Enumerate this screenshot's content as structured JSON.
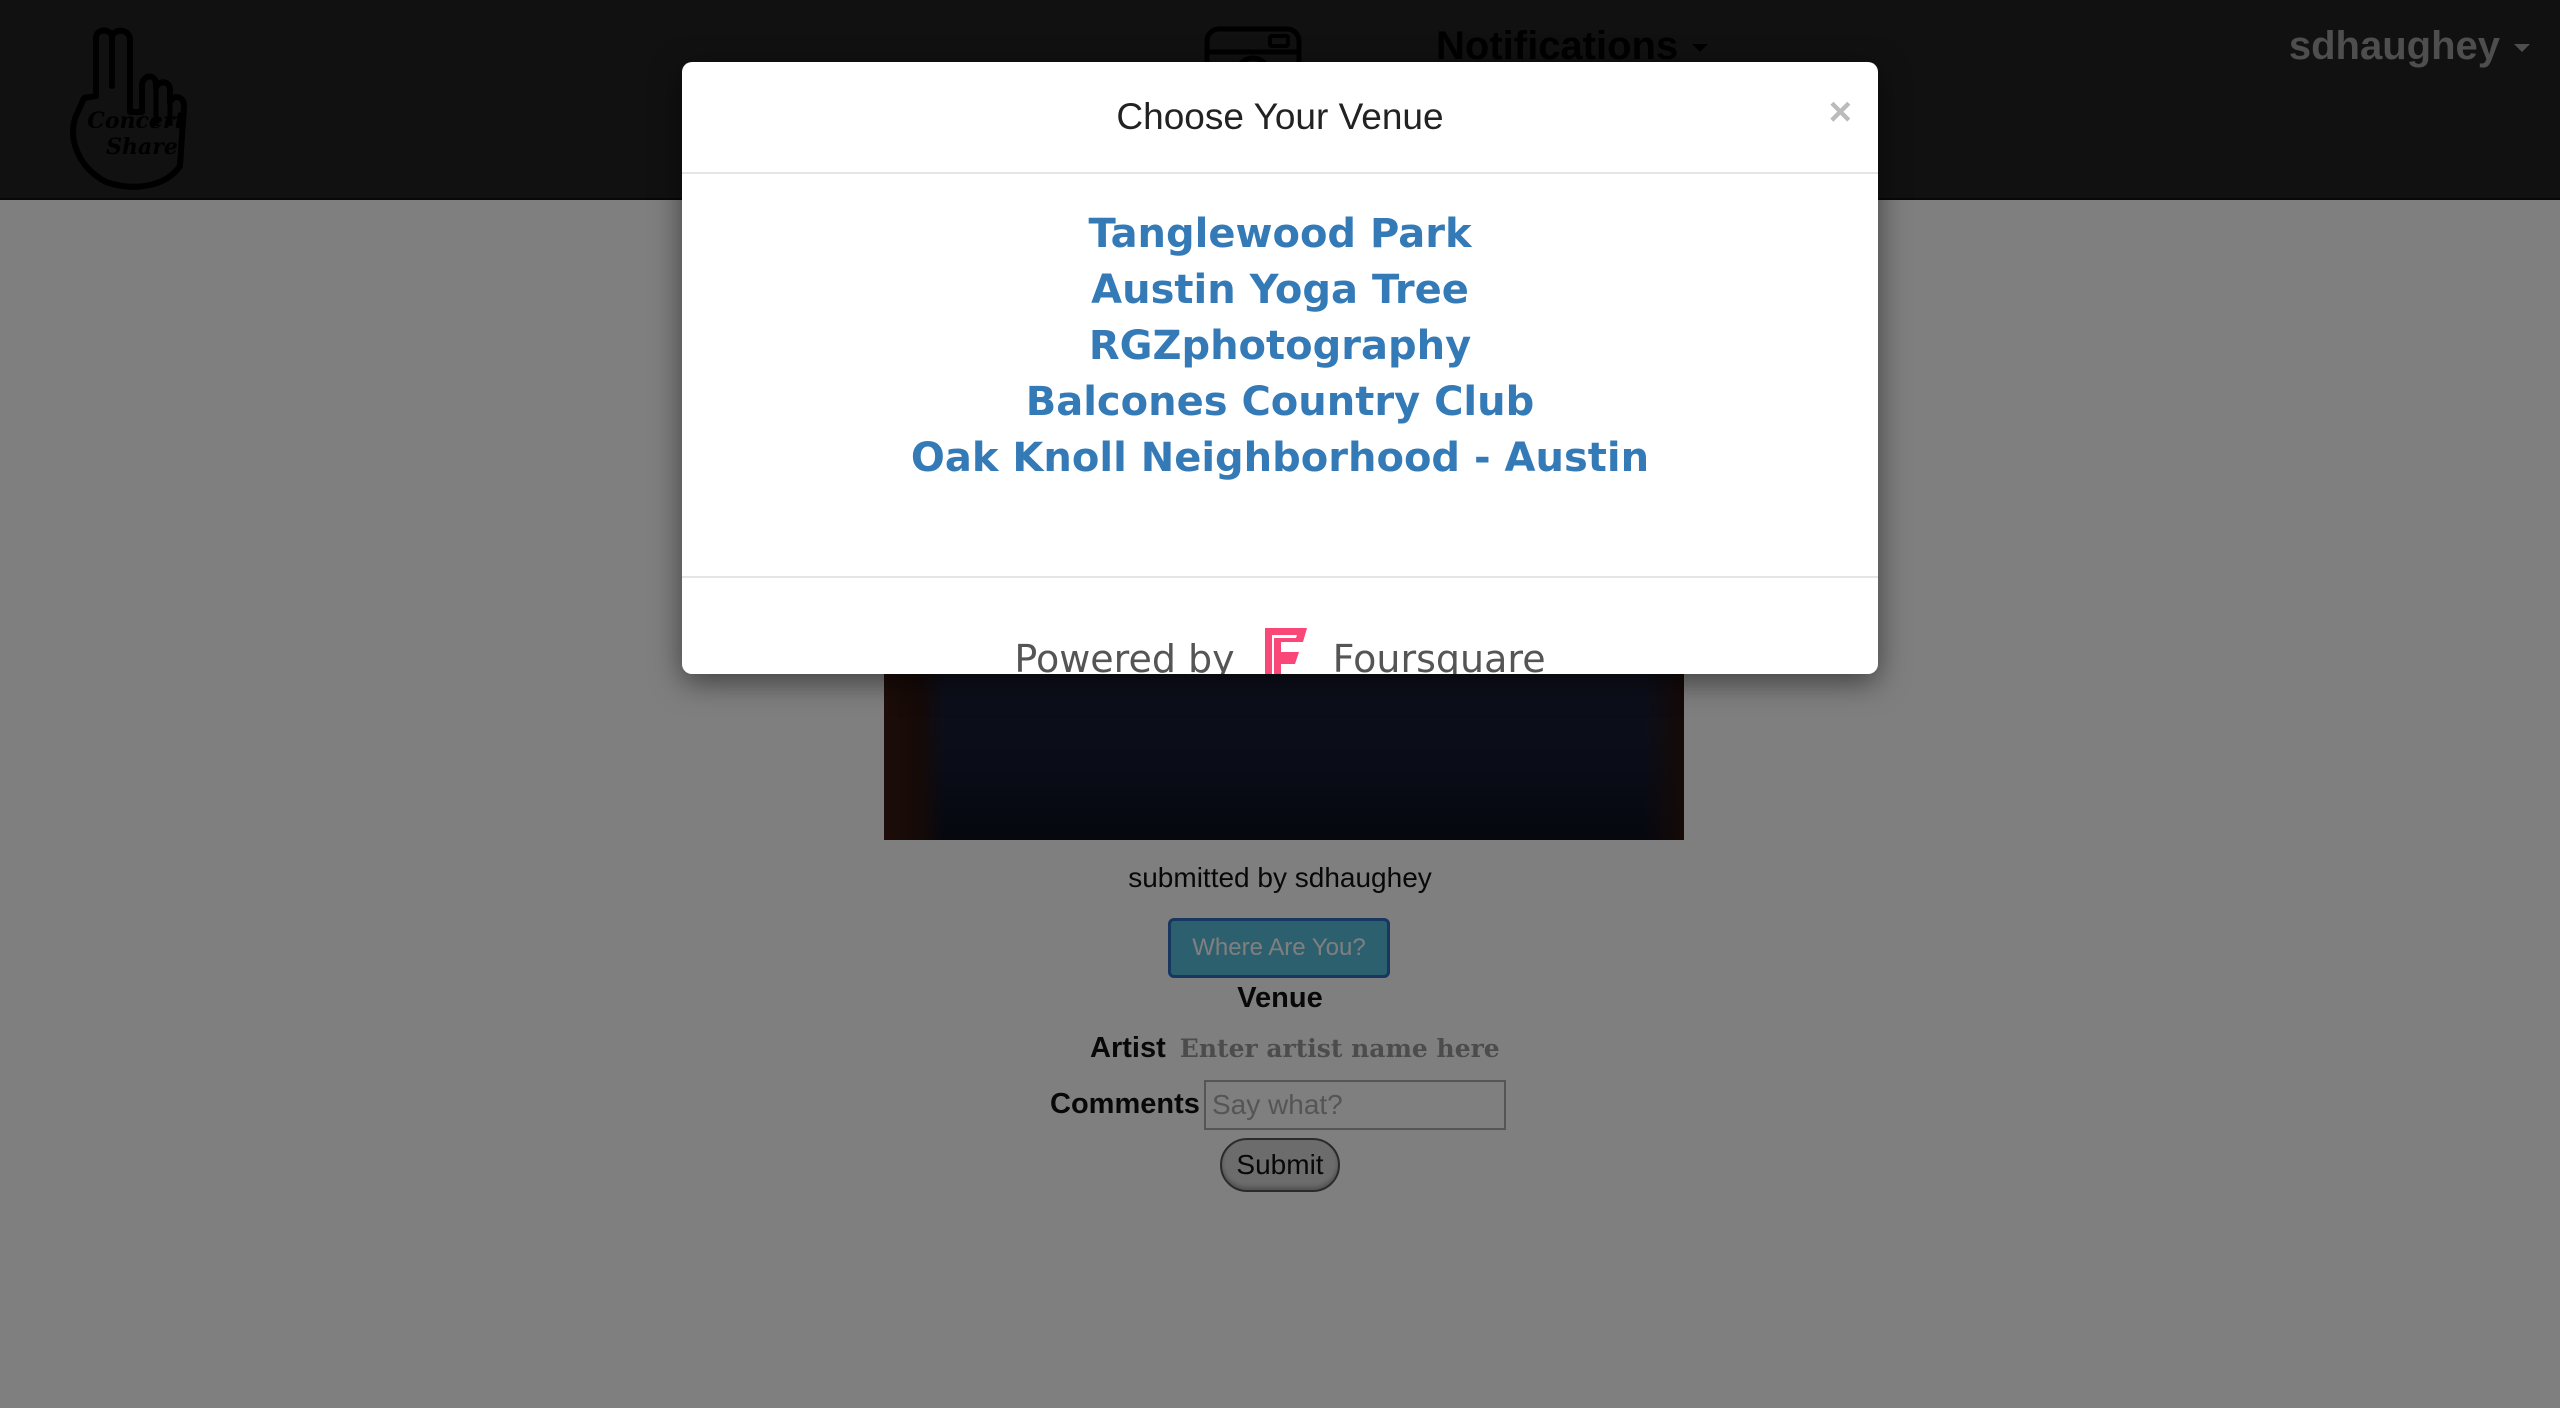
{
  "nav": {
    "brand_logo_text": "Concert Share",
    "notifications_label": "Notifications",
    "user_label": "sdhaughey"
  },
  "post": {
    "submitted_by": "submitted by sdhaughey",
    "where_button": "Where Are You?",
    "venue_label": "Venue",
    "artist_label": "Artist",
    "artist_value": "Enter artist name here",
    "comments_label": "Comments",
    "comments_placeholder": "Say what?",
    "submit_label": "Submit"
  },
  "modal": {
    "title": "Choose Your Venue",
    "close_symbol": "×",
    "venues": [
      "Tanglewood Park",
      "Austin Yoga Tree",
      "RGZphotography",
      "Balcones Country Club",
      "Oak Knoll Neighborhood - Austin"
    ],
    "powered_by": "Powered by",
    "provider": "Foursquare"
  },
  "colors": {
    "link": "#337ab7",
    "foursquare_pink": "#f94877",
    "navbar": "#222222",
    "button_info": "#5bc0de"
  }
}
